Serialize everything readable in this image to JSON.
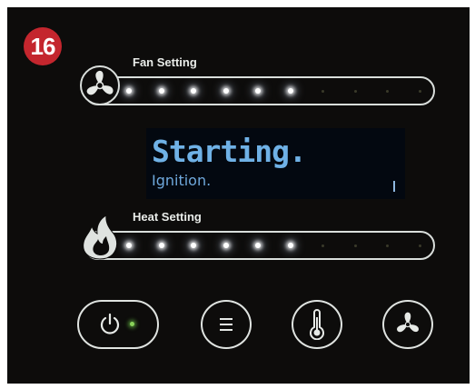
{
  "badge": {
    "number": "16"
  },
  "fan_setting": {
    "label": "Fan Setting",
    "icon": "fan-icon",
    "level": 6,
    "max_level": 10
  },
  "display": {
    "status": "Starting.",
    "detail": "Ignition."
  },
  "heat_setting": {
    "label": "Heat Setting",
    "icon": "flame-icon",
    "level": 6,
    "max_level": 10
  },
  "buttons": [
    {
      "name": "power-button",
      "icon": "power-icon",
      "indicator": "on"
    },
    {
      "name": "menu-button",
      "icon": "menu-icon"
    },
    {
      "name": "temperature-button",
      "icon": "thermometer-icon"
    },
    {
      "name": "fan-button",
      "icon": "fan-icon"
    }
  ],
  "colors": {
    "badge": "#c4262e",
    "display_text": "#6fb1e6",
    "led_on": "#ffffff",
    "power_indicator": "#8ad35a"
  }
}
